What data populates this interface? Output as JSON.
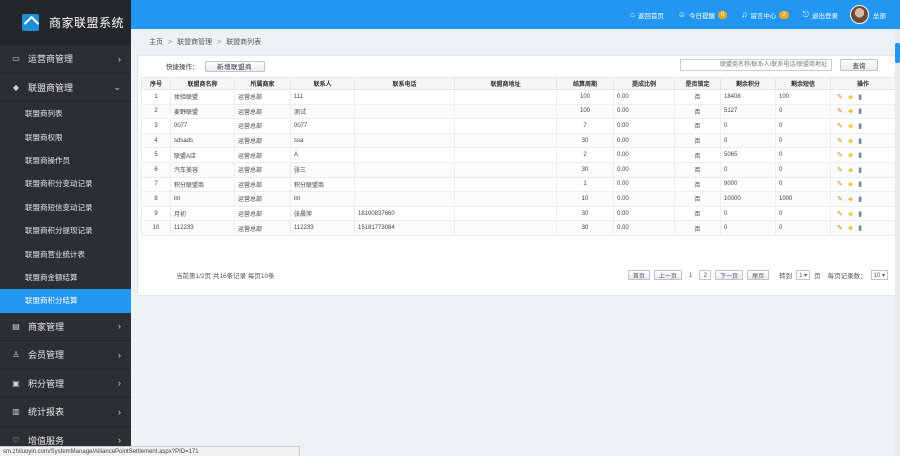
{
  "app": {
    "title": "商家联盟系统"
  },
  "sidebar": {
    "groups": [
      {
        "label": "运营商管理",
        "icon": "monitor-icon",
        "expanded": false
      },
      {
        "label": "联盟商管理",
        "icon": "diamond-icon",
        "expanded": true
      },
      {
        "label": "商家管理",
        "icon": "store-icon",
        "expanded": false
      },
      {
        "label": "会员管理",
        "icon": "user-icon",
        "expanded": false
      },
      {
        "label": "积分管理",
        "icon": "card-icon",
        "expanded": false
      },
      {
        "label": "统计报表",
        "icon": "chart-icon",
        "expanded": false
      },
      {
        "label": "增值服务",
        "icon": "heart-icon",
        "expanded": false
      }
    ],
    "sub_items": [
      "联盟商列表",
      "联盟商权限",
      "联盟商操作员",
      "联盟商积分变动记录",
      "联盟商短信变动记录",
      "联盟商积分提现记录",
      "联盟商营业统计表",
      "联盟商金额结算",
      "联盟商积分结算"
    ],
    "active_sub_index": 8
  },
  "topbar": {
    "home": "返回首页",
    "reminder": "今日提醒",
    "reminder_count": "0",
    "messages": "留言中心",
    "messages_count": "2",
    "logout": "退出登录",
    "user": "总部"
  },
  "breadcrumb": {
    "home": "主页",
    "sep": ">",
    "section": "联盟商管理",
    "page": "联盟商列表"
  },
  "toolbar": {
    "quick_label": "快捷操作：",
    "add_button": "新增联盟商",
    "search_placeholder": "联盟商名称/联系人/联系电话/联盟商地址",
    "search_button": "查询"
  },
  "table": {
    "columns": [
      "序号",
      "联盟商名称",
      "所属商家",
      "联系人",
      "联系电话",
      "联盟商地址",
      "结算周期",
      "提成比例",
      "是否锁定",
      "剩余积分",
      "剩余短信",
      "操作"
    ],
    "rows": [
      [
        "1",
        "体验联盟",
        "运营总部",
        "111",
        "",
        "",
        "100",
        "0.00",
        "否",
        "18408",
        "100"
      ],
      [
        "2",
        "麦野联盟",
        "运营总部",
        "测试",
        "",
        "",
        "100",
        "0.00",
        "否",
        "5127",
        "0"
      ],
      [
        "3",
        "0077",
        "运营总部",
        "0077",
        "",
        "",
        "7",
        "0.00",
        "否",
        "0",
        "0"
      ],
      [
        "4",
        "sdsads",
        "运营总部",
        "ssa",
        "",
        "",
        "30",
        "0.00",
        "否",
        "0",
        "0"
      ],
      [
        "5",
        "联盟A店",
        "运营总部",
        "A",
        "",
        "",
        "2",
        "0.00",
        "否",
        "5065",
        "0"
      ],
      [
        "6",
        "汽车美容",
        "运营总部",
        "张三",
        "",
        "",
        "30",
        "0.00",
        "否",
        "0",
        "0"
      ],
      [
        "7",
        "积分联盟商",
        "运营总部",
        "积分联盟商",
        "",
        "",
        "1",
        "0.00",
        "否",
        "9000",
        "0"
      ],
      [
        "8",
        "lm",
        "运营总部",
        "lm",
        "",
        "",
        "10",
        "0.00",
        "否",
        "10000",
        "1000"
      ],
      [
        "9",
        "月初",
        "运营总部",
        "张晨萍",
        "18100837660",
        "",
        "30",
        "0.00",
        "否",
        "0",
        "0"
      ],
      [
        "10",
        "112233",
        "运营总部",
        "112233",
        "15181773084",
        "",
        "30",
        "0.00",
        "否",
        "0",
        "0"
      ]
    ]
  },
  "pagination": {
    "info": "当前第1/2页 共16条记录 每页10条",
    "first": "首页",
    "prev": "上一页",
    "page1": "1",
    "page2": "2",
    "next": "下一页",
    "last": "尾页",
    "goto_label": "转到",
    "goto_value": "1 ▾",
    "page_unit": "页",
    "per_page_label": "每页记录数：",
    "per_page_value": "10 ▾"
  },
  "status_bar": {
    "url": "sm.zhiluoyin.com/SystemManage/AlliancePointSettlement.aspx?PID=171"
  },
  "colors": {
    "accent": "#2196f3",
    "sidebar_bg": "#2b2e33",
    "badge": "#f5a623"
  }
}
